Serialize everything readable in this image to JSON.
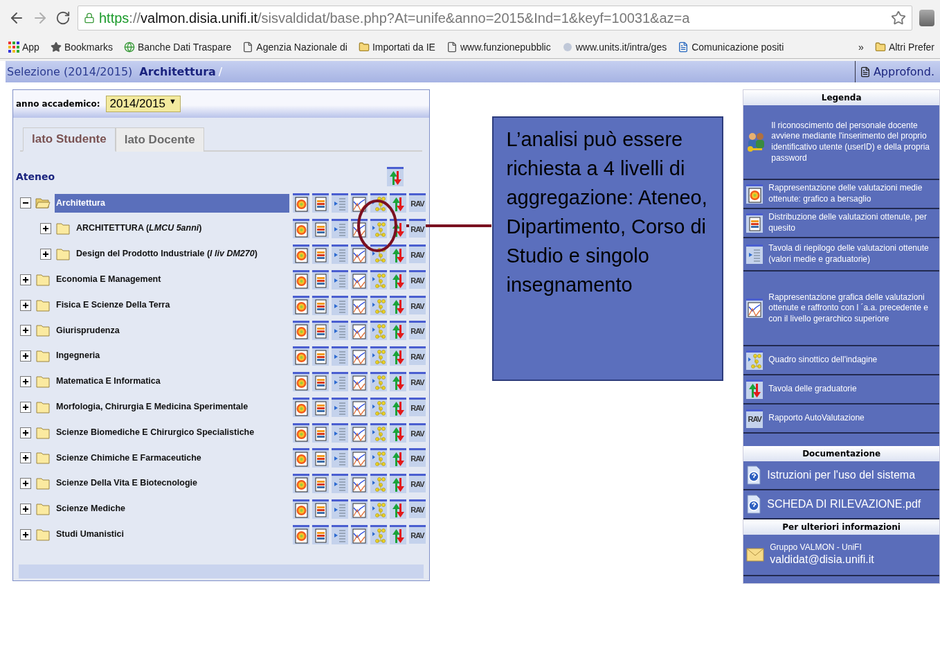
{
  "browser": {
    "url": {
      "scheme": "https",
      "separator": "://",
      "host": "valmon.disia.unifi.it",
      "path": "/sisvaldidat/base.php?At=unife&anno=2015&Ind=1&keyf=10031&az=a"
    },
    "bookmarks": [
      {
        "kind": "apps",
        "label": "App"
      },
      {
        "kind": "star",
        "label": "Bookmarks"
      },
      {
        "kind": "globe",
        "label": "Banche Dati Traspare"
      },
      {
        "kind": "page",
        "label": "Agenzia Nazionale di"
      },
      {
        "kind": "folder",
        "label": "Importati da IE"
      },
      {
        "kind": "page",
        "label": "www.funzionepubblic"
      },
      {
        "kind": "site",
        "label": "www.units.it/intra/ges"
      },
      {
        "kind": "doc",
        "label": "Comunicazione positi"
      }
    ],
    "more": "»",
    "other_bookmarks": "Altri Prefer"
  },
  "breadcrumb": {
    "prefix": "Selezione (2014/2015)",
    "current": "Architettura",
    "separator": "/",
    "more_link": "Approfond."
  },
  "panel": {
    "year_label": "anno accademico:",
    "year_value": "2014/2015",
    "year_caret": "▼",
    "tabs": [
      {
        "label": "lato Studente",
        "selected": true
      },
      {
        "label": "lato Docente",
        "selected": false
      }
    ],
    "root_label": "Ateneo",
    "tree": [
      {
        "label": "Architettura",
        "expanded": true,
        "selected": true,
        "rav": "RAV",
        "children": [
          {
            "label": "ARCHITETTURA (*LMCU 5anni*)",
            "expanded": false,
            "selected": false,
            "rav": "RAV"
          },
          {
            "label": "Design del Prodotto Industriale (*I liv DM270*)",
            "expanded": false,
            "selected": false,
            "rav": "RAV"
          }
        ]
      },
      {
        "label": "Economia E Management",
        "expanded": false,
        "selected": false,
        "rav": "RAV"
      },
      {
        "label": "Fisica E Scienze Della Terra",
        "expanded": false,
        "selected": false,
        "rav": "RAV"
      },
      {
        "label": "Giurisprudenza",
        "expanded": false,
        "selected": false,
        "rav": "RAV"
      },
      {
        "label": "Ingegneria",
        "expanded": false,
        "selected": false,
        "rav": "RAV"
      },
      {
        "label": "Matematica E Informatica",
        "expanded": false,
        "selected": false,
        "rav": "RAV"
      },
      {
        "label": "Morfologia, Chirurgia E Medicina Sperimentale",
        "expanded": false,
        "selected": false,
        "rav": "RAV"
      },
      {
        "label": "Scienze Biomediche E Chirurgico Specialistiche",
        "expanded": false,
        "selected": false,
        "rav": "RAV"
      },
      {
        "label": "Scienze Chimiche E Farmaceutiche",
        "expanded": false,
        "selected": false,
        "rav": "RAV"
      },
      {
        "label": "Scienze Della Vita E Biotecnologie",
        "expanded": false,
        "selected": false,
        "rav": "RAV"
      },
      {
        "label": "Scienze Mediche",
        "expanded": false,
        "selected": false,
        "rav": "RAV"
      },
      {
        "label": "Studi Umanistici",
        "expanded": false,
        "selected": false,
        "rav": "RAV"
      }
    ]
  },
  "callout": "L’analisi può essere richiesta a 4 livelli di aggregazione: Ateneo, Dipartimento, Corso di Studio e singolo insegnamento",
  "legend": {
    "title": "Legenda",
    "items": [
      {
        "kind": "users",
        "text": "Il riconoscimento del personale docente avviene mediante l'inserimento del proprio identificativo utente (userID) e della propria password"
      },
      {
        "kind": "target",
        "text": "Rappresentazione delle valutazioni medie ottenute: grafico a bersaglio"
      },
      {
        "kind": "distribution",
        "text": "Distribuzione delle valutazioni ottenute, per quesito"
      },
      {
        "kind": "table",
        "text": "Tavola di riepilogo delle valutazioni ottenute (valori medie e graduatorie)"
      },
      {
        "kind": "chart",
        "text": "Rappresentazione grafica delle valutazioni ottenute e raffronto con l ´a.a. precedente e con il livello gerarchico superiore"
      },
      {
        "kind": "synoptic",
        "text": "Quadro sinottico dell'indagine"
      },
      {
        "kind": "ranking",
        "text": "Tavola delle graduatorie"
      },
      {
        "kind": "rav",
        "icon_text": "RAV",
        "text": "Rapporto AutoValutazione"
      }
    ]
  },
  "documentation": {
    "title": "Documentazione",
    "items": [
      "Istruzioni per l'uso del sistema",
      "SCHEDA DI RILEVAZIONE.pdf"
    ]
  },
  "contact": {
    "title": "Per ulteriori informazioni",
    "name": "Gruppo VALMON - UniFI",
    "email": "valdidat@disia.unifi.it"
  }
}
